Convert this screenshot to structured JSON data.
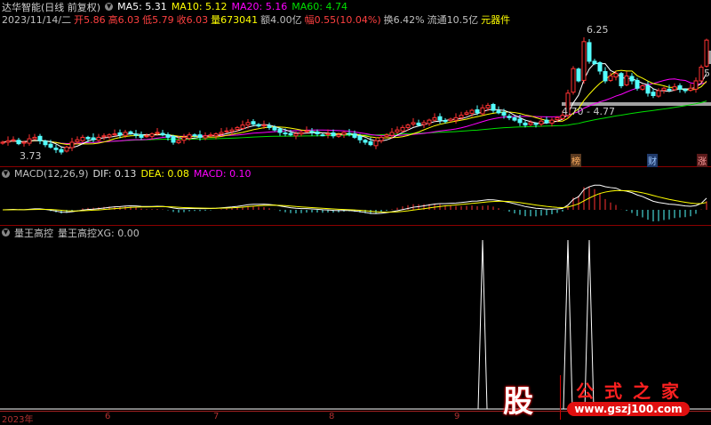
{
  "header": {
    "stock_name": "达华智能(日线 前复权)",
    "ma5": "MA5: 5.31",
    "ma10": "MA10: 5.12",
    "ma20": "MA20: 5.16",
    "ma60": "MA60: 4.74"
  },
  "quote": {
    "date": "2023/11/14/二",
    "open": "开5.86",
    "high": "高6.03",
    "low": "低5.79",
    "close": "收6.03",
    "volume": "量673041",
    "amount": "额4.00亿",
    "change": "幅0.55(10.04%)",
    "turnover": "换6.42%",
    "float": "流通10.5亿",
    "sector": "元器件"
  },
  "price_labels": {
    "high_label": "6.25",
    "low_label": "3.73",
    "range_label": "4.70 - 4.77",
    "right_label": "5."
  },
  "markers": [
    "榜",
    "财",
    "涨"
  ],
  "macd": {
    "title": "MACD(12,26,9)",
    "dif": "DIF: 0.13",
    "dea": "DEA: 0.08",
    "macd": "MACD: 0.10"
  },
  "indicator": {
    "title": "量王高控",
    "xg": "量王高控XG: 0.00"
  },
  "x_axis": [
    "2023年",
    "6",
    "7",
    "8",
    "9"
  ],
  "watermark": {
    "logo": "股",
    "name": "公式之家",
    "url": "www.gszj100.com"
  },
  "colors": {
    "up": "#ff3232",
    "down": "#54ffff",
    "ma5": "#ffffff",
    "ma10": "#ffff00",
    "ma20": "#ff00ff",
    "ma60": "#00e000",
    "dea": "#ffff00"
  },
  "chart_data": {
    "type": "candlestick",
    "closes": [
      3.95,
      3.98,
      4.0,
      3.92,
      3.95,
      4.02,
      4.05,
      3.98,
      3.9,
      3.85,
      3.8,
      3.75,
      3.85,
      3.95,
      4.0,
      4.05,
      4.02,
      4.0,
      4.05,
      4.08,
      4.1,
      4.12,
      4.1,
      4.15,
      4.13,
      4.1,
      4.05,
      4.08,
      4.12,
      4.15,
      4.1,
      4.05,
      3.95,
      3.98,
      4.05,
      4.1,
      4.08,
      4.05,
      4.08,
      4.1,
      4.12,
      4.15,
      4.18,
      4.2,
      4.25,
      4.3,
      4.35,
      4.32,
      4.28,
      4.3,
      4.25,
      4.2,
      4.15,
      4.12,
      4.1,
      4.12,
      4.15,
      4.18,
      4.15,
      4.12,
      4.1,
      4.12,
      4.08,
      4.1,
      4.15,
      4.12,
      4.05,
      4.0,
      3.95,
      3.9,
      3.98,
      4.05,
      4.1,
      4.15,
      4.2,
      4.25,
      4.3,
      4.35,
      4.3,
      4.35,
      4.4,
      4.45,
      4.4,
      4.38,
      4.42,
      4.45,
      4.5,
      4.55,
      4.6,
      4.55,
      4.65,
      4.7,
      4.6,
      4.55,
      4.5,
      4.45,
      4.4,
      4.35,
      4.3,
      4.35,
      4.32,
      4.38,
      4.35,
      4.4,
      4.45,
      4.5,
      4.95,
      5.45,
      5.2,
      6.0,
      5.6,
      5.55,
      5.4,
      5.2,
      5.3,
      5.35,
      5.1,
      5.3,
      5.2,
      5.05,
      5.1,
      4.95,
      4.9,
      5.0,
      5.05,
      5.02,
      5.08,
      5.03,
      5.0,
      5.05,
      5.2,
      5.48,
      6.03
    ],
    "xg_signal_indices": [
      90,
      106,
      110
    ]
  }
}
